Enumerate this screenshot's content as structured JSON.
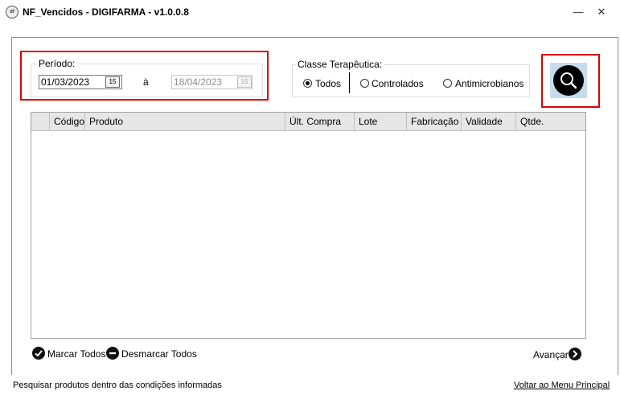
{
  "window": {
    "title": "NF_Vencidos - DIGIFARMA - v1.0.0.8",
    "icon_text": "df",
    "minimize_label": "—",
    "close_label": "✕"
  },
  "periodo": {
    "legend": "Período:",
    "start_date": "01/03/2023",
    "separator": "à",
    "end_date": "18/04/2023",
    "calendar_glyph": "15"
  },
  "classe": {
    "legend": "Classe Terapêutica:",
    "options": [
      {
        "label": "Todos",
        "selected": true
      },
      {
        "label": "Controlados",
        "selected": false
      },
      {
        "label": "Antimicrobianos",
        "selected": false
      }
    ]
  },
  "grid": {
    "columns": [
      "",
      "Código",
      "Produto",
      "Últ. Compra",
      "Lote",
      "Fabricação",
      "Validade",
      "Qtde."
    ],
    "rows": []
  },
  "actions": {
    "marcar_todos": "Marcar Todos",
    "desmarcar_todos": "Desmarcar Todos",
    "avancar": "Avançar"
  },
  "statusbar": {
    "message": "Pesquisar produtos dentro das condições informadas",
    "menu_link": "Voltar ao Menu Principal"
  },
  "colors": {
    "highlight_border": "#e00000",
    "search_button_bg": "#c5dbee"
  },
  "icons": {
    "search": "search-icon",
    "calendar": "calendar-icon",
    "check": "check-circle-icon",
    "minus": "minus-circle-icon",
    "arrow": "arrow-right-circle-icon"
  }
}
